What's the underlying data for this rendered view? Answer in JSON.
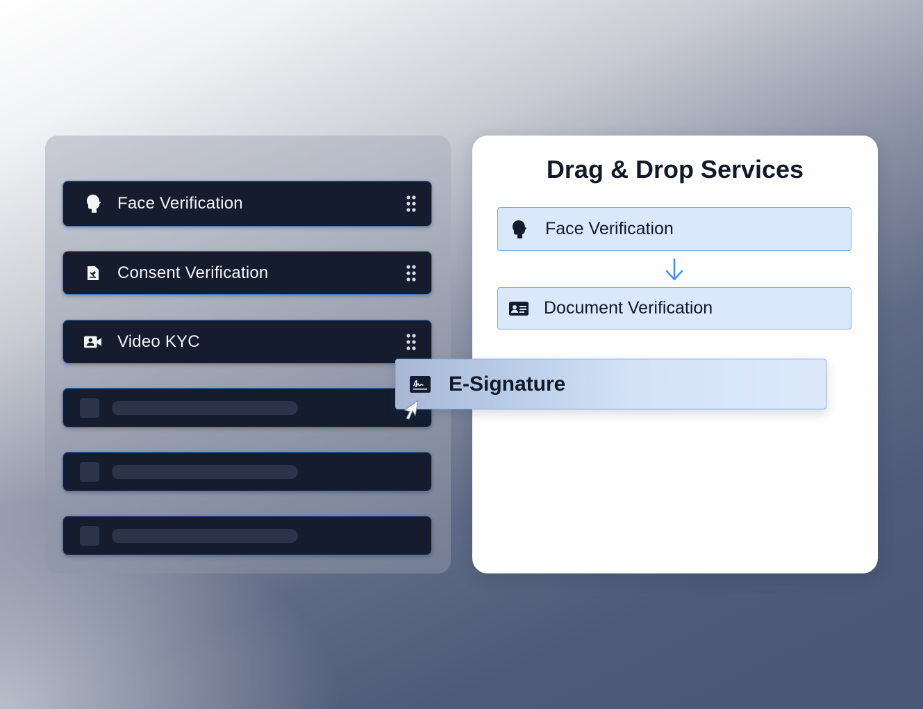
{
  "palette": {
    "items": [
      {
        "label": "Face Verification",
        "icon": "face-icon"
      },
      {
        "label": "Consent Verification",
        "icon": "consent-document-icon"
      },
      {
        "label": "Video KYC",
        "icon": "video-kyc-icon"
      }
    ],
    "placeholders": 3
  },
  "canvas": {
    "title": "Drag & Drop Services",
    "flow": [
      {
        "label": "Face Verification",
        "icon": "face-icon"
      },
      {
        "label": "Document Verification",
        "icon": "id-card-icon"
      }
    ],
    "dragging": {
      "label": "E-Signature",
      "icon": "signature-icon"
    }
  },
  "colors": {
    "item_bg": "#141c2e",
    "item_border": "#3f73c4",
    "flow_bg": "#dbe8fb",
    "flow_border": "#7aaae8",
    "arrow": "#4a90e2"
  }
}
